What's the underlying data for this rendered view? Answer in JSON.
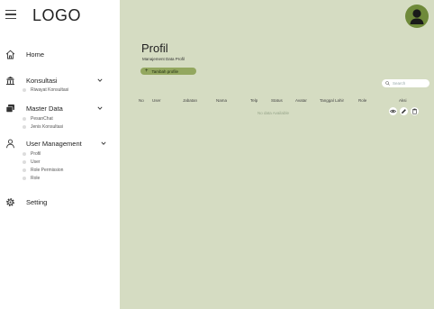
{
  "sidebar": {
    "logo": "LOGO",
    "home": "Home",
    "konsultasi": {
      "label": "Konsultasi",
      "items": [
        "Riwayat Konsultasi"
      ]
    },
    "master_data": {
      "label": "Master Data",
      "items": [
        "PesanChat",
        "Jenis Konsultasi"
      ]
    },
    "user_management": {
      "label": "User Management",
      "items": [
        "Profil",
        "User",
        "Role Permission",
        "Role"
      ]
    },
    "setting": "Setting"
  },
  "main": {
    "title": "Profil",
    "subtitle": "Manajement Data Profil",
    "add_button": "Tambah profile",
    "search_placeholder": "Search",
    "columns": [
      "No",
      "User",
      "Jabatan",
      "Nama",
      "Telp",
      "Status",
      "Avatar",
      "Tanggal Lahir",
      "Role",
      "Aksi"
    ],
    "empty_text": "No data Available"
  },
  "colors": {
    "main_bg": "#d5dcc2",
    "accent": "#93a75f",
    "avatar": "#6f8a3a"
  }
}
